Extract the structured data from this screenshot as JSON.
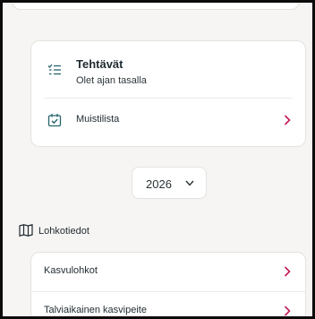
{
  "tasks": {
    "title": "Tehtävät",
    "subtitle": "Olet ajan tasalla",
    "icon": "task-list-icon"
  },
  "memo": {
    "label": "Muistilista",
    "icon": "calendar-check-icon"
  },
  "year_selector": {
    "value": "2026",
    "icon": "chevron-down-icon"
  },
  "section": {
    "label": "Lohkotiedot",
    "icon": "map-icon"
  },
  "list": {
    "items": [
      {
        "label": "Kasvulohkot"
      },
      {
        "label": "Talviaikainen kasvipeite"
      }
    ]
  },
  "colors": {
    "accent": "#c2185b",
    "icon": "#26646f",
    "background": "#f6f5f3",
    "card": "#ffffff"
  }
}
